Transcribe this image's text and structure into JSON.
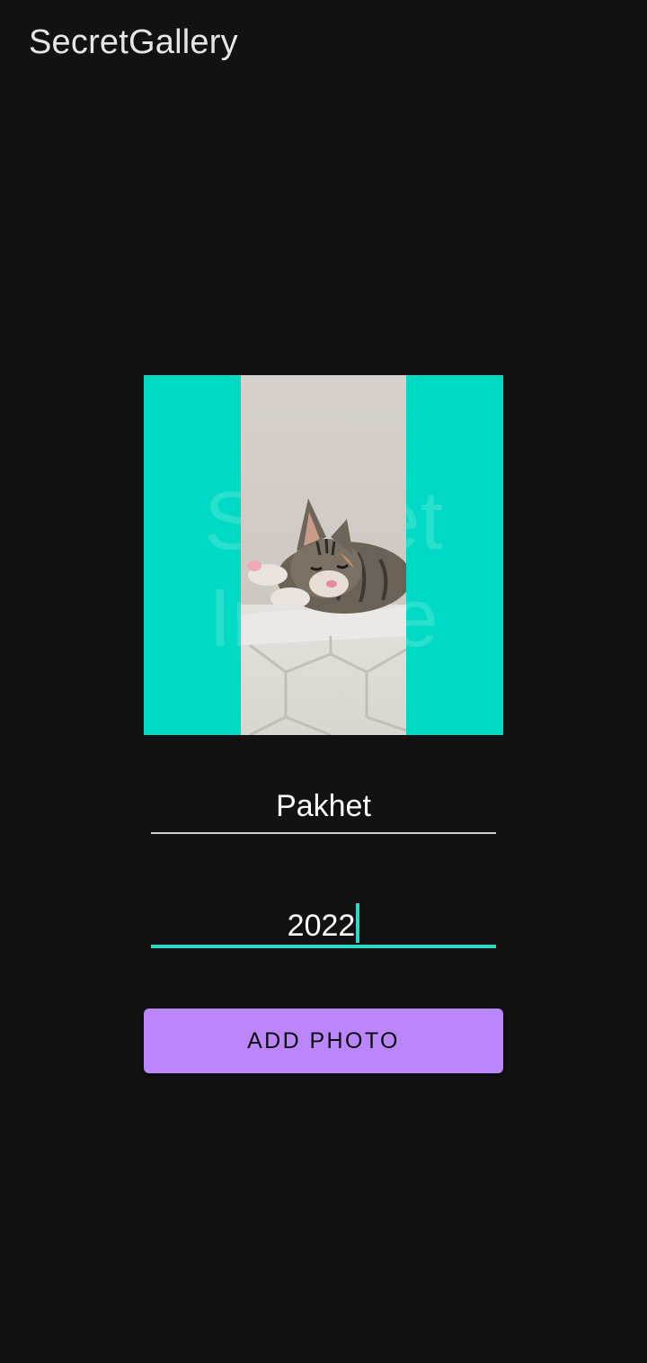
{
  "app": {
    "title": "SecretGallery"
  },
  "image": {
    "placeholder_text": "Secret Image",
    "background_color": "#00d9c4",
    "photo_subject": "tabby kitten lying on a quilted cushion"
  },
  "form": {
    "name_value": "Pakhet",
    "year_value": "2022",
    "add_button_label": "ADD PHOTO"
  },
  "colors": {
    "background": "#121212",
    "accent": "#2fd6c2",
    "button": "#bb86fc"
  }
}
